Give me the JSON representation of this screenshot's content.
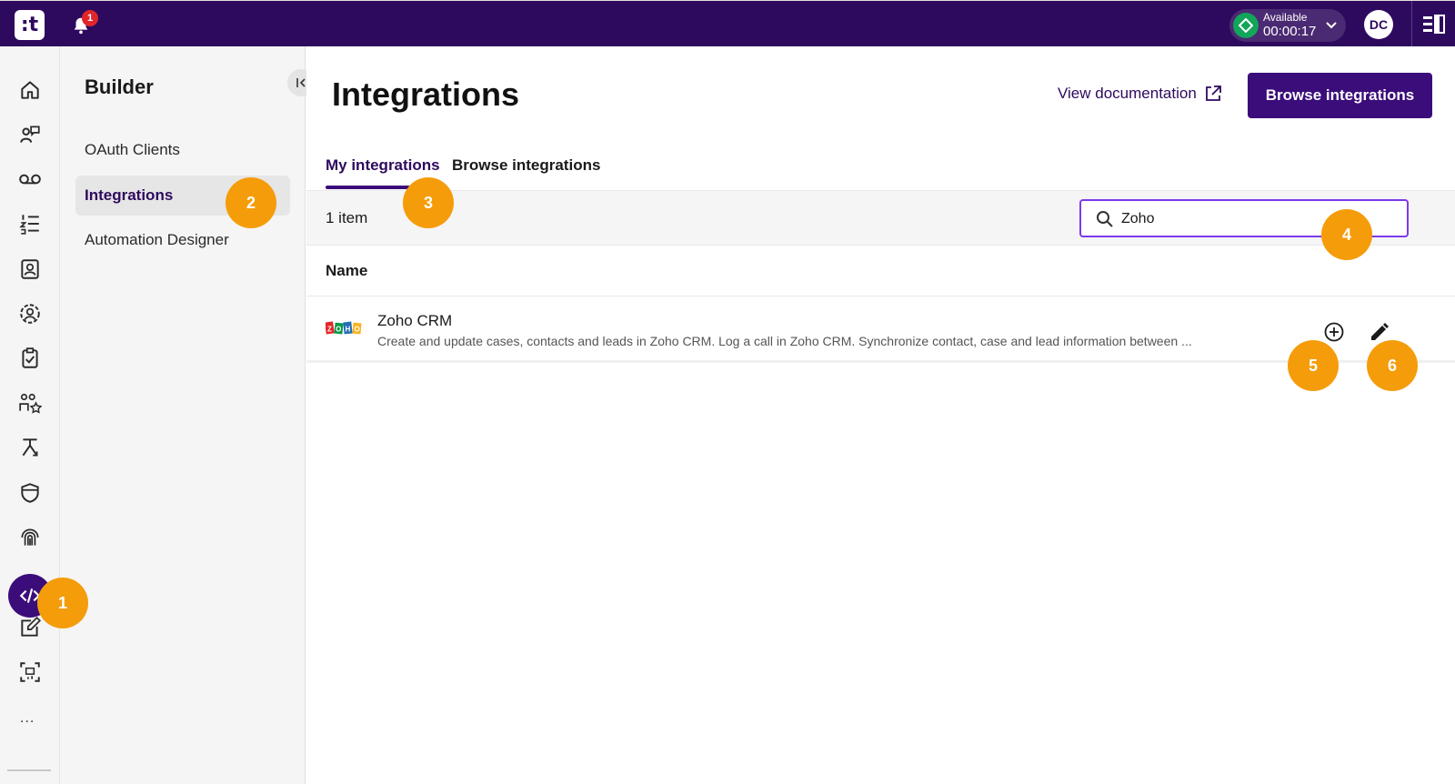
{
  "topbar": {
    "logo_text": ":t",
    "notification_count": "1",
    "status_label": "Available",
    "status_timer": "00:00:17",
    "avatar_initials": "DC",
    "brand_color": "#2e0a5e",
    "status_color": "#13a55a"
  },
  "rail": {
    "icons": [
      "home-icon",
      "headset-icon",
      "voicemail-icon",
      "numbered-list-icon",
      "contact-book-icon",
      "user-circle-icon",
      "clipboard-check-icon",
      "users-star-icon",
      "routing-icon",
      "shield-icon",
      "fingerprint-icon",
      "code-icon",
      "edit-square-icon",
      "monitor-icon"
    ],
    "more_label": "...",
    "active_icon": "code-icon"
  },
  "subnav": {
    "title": "Builder",
    "items": [
      {
        "label": "OAuth Clients",
        "active": false
      },
      {
        "label": "Integrations",
        "active": true
      },
      {
        "label": "Automation Designer",
        "active": false
      }
    ]
  },
  "main": {
    "title": "Integrations",
    "doc_link": "View documentation",
    "primary_button": "Browse integrations",
    "tabs": [
      {
        "label": "My integrations",
        "active": true
      },
      {
        "label": "Browse integrations",
        "active": false
      }
    ],
    "item_count": "1 item",
    "search": {
      "value": "Zoho",
      "placeholder": ""
    },
    "column_header": "Name",
    "rows": [
      {
        "name": "Zoho CRM",
        "description": "Create and update cases, contacts and leads in Zoho CRM. Log a call in Zoho CRM. Synchronize contact, case and lead information between ...",
        "logo": "ZOHO"
      }
    ]
  },
  "markers": [
    "1",
    "2",
    "3",
    "4",
    "5",
    "6"
  ],
  "accent_color": "#3b0d7a",
  "marker_color": "#f59c0a"
}
